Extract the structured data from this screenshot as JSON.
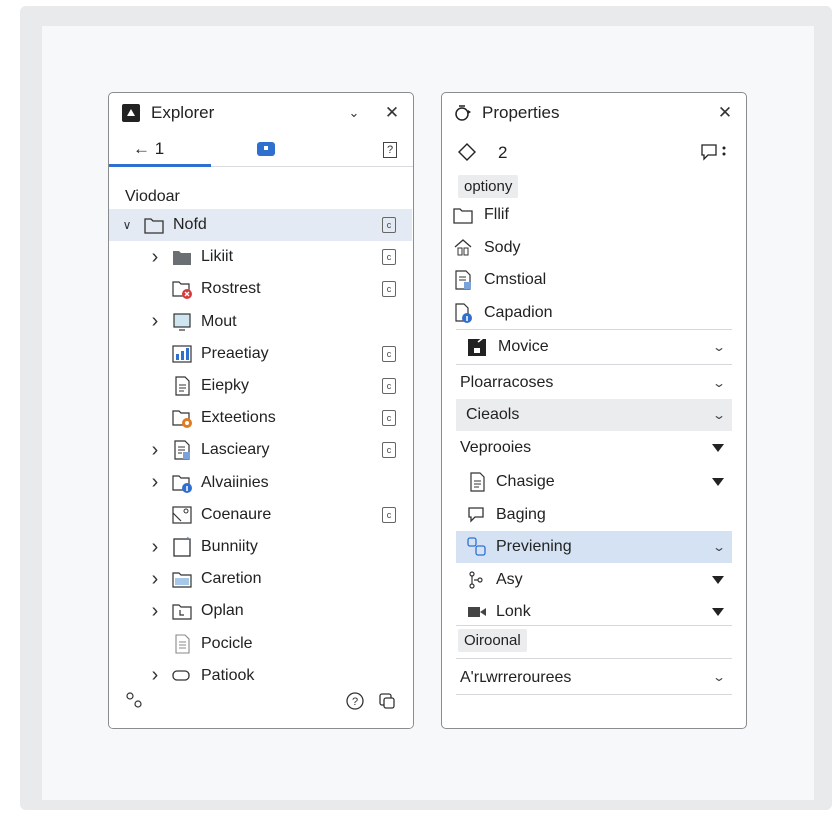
{
  "explorer": {
    "title": "Explorer",
    "back_label": "← 1",
    "section_label": "Viodoar",
    "tree": [
      {
        "label": "Nofd",
        "expanded": true,
        "icon": "folder-outline-icon",
        "selected": true,
        "action": true
      },
      {
        "label": "Likiit",
        "chevron": true,
        "icon": "folder-filled-icon",
        "action": true
      },
      {
        "label": "Rostrest",
        "icon": "folder-error-icon",
        "action": true
      },
      {
        "label": "Mout",
        "chevron": true,
        "icon": "monitor-icon",
        "action": false
      },
      {
        "label": "Preaetiay",
        "icon": "chart-icon",
        "action": true
      },
      {
        "label": "Eiepky",
        "icon": "document-icon",
        "action": true
      },
      {
        "label": "Exteetions",
        "icon": "folder-extension-icon",
        "action": true
      },
      {
        "label": "Lascieary",
        "chevron": true,
        "icon": "document-list-icon",
        "action": true
      },
      {
        "label": "Alvaiinies",
        "chevron": true,
        "icon": "folder-info-icon",
        "action": false
      },
      {
        "label": "Coenaure",
        "icon": "image-icon",
        "action": true
      },
      {
        "label": "Bunniity",
        "chevron": true,
        "icon": "page-icon",
        "action": false
      },
      {
        "label": "Caretion",
        "chevron": true,
        "icon": "folder-blue-icon",
        "action": false
      },
      {
        "label": "Oplan",
        "chevron": true,
        "icon": "folder-l-icon",
        "action": false
      },
      {
        "label": "Pocicle",
        "icon": "text-file-icon",
        "action": false
      },
      {
        "label": "Patiook",
        "chevron": true,
        "icon": "tag-icon",
        "action": false
      }
    ]
  },
  "properties": {
    "title": "Properties",
    "count": "2",
    "chip1": "optiony",
    "items": [
      {
        "label": "Fllif",
        "icon": "folder-outline-icon"
      },
      {
        "label": "Sody",
        "icon": "home-icon"
      },
      {
        "label": "Cmstioal",
        "icon": "document-settings-icon"
      },
      {
        "label": "Capadion",
        "icon": "file-info-icon"
      }
    ],
    "movice": "Movice",
    "sections": [
      {
        "label": "Ploarracoses"
      },
      {
        "label": "Cieaols"
      },
      {
        "label": "Veprooies"
      }
    ],
    "sub_items": [
      {
        "label": "Chasige",
        "icon": "document-icon"
      },
      {
        "label": "Baging",
        "icon": "comment-icon"
      },
      {
        "label": "Previening",
        "icon": "shapes-icon"
      },
      {
        "label": "Asy",
        "icon": "branch-icon"
      },
      {
        "label": "Lonk",
        "icon": "video-icon"
      }
    ],
    "chip2": "Oiroonal",
    "last_section": "A'rւwrrerourees"
  }
}
